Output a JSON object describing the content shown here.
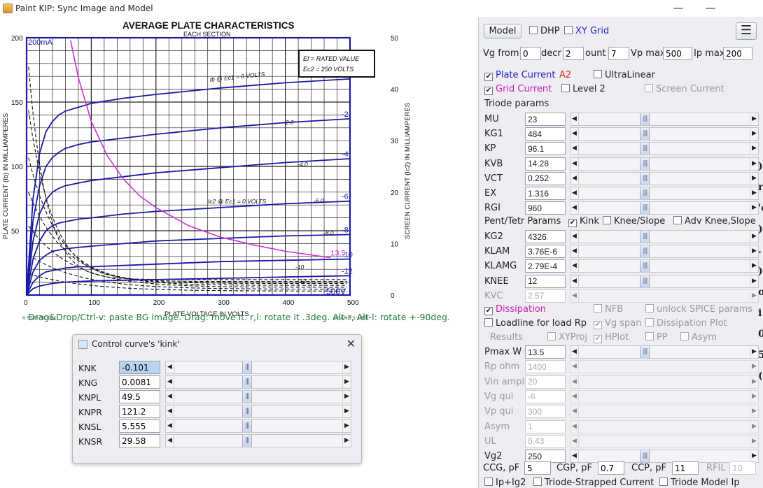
{
  "window": {
    "title": "Paint KIP: Sync Image and Model",
    "min": "—",
    "max": "☐",
    "close": "✕"
  },
  "graph": {
    "title": "AVERAGE PLATE CHARACTERISTICS",
    "subtitle": "EACH SECTION",
    "ylabel_left": "PLATE CURRENT (Ib) IN MILLIAMPERES",
    "ylabel_right": "SCREEN CURRENT (Ic2) IN MILLIAMPERES",
    "xlabel": "PLATE VOLTAGE IN VOLTS",
    "overlay_left_top": "200mA",
    "overlay_right_bottom": "500V",
    "legend_line1": "Ef = RATED VALUE",
    "legend_line2": "Ec2 = 250 VOLTS",
    "curve_label_ec1": "Ib @ Ec1 = 0 VOLTS",
    "curve_label_ic2": "Ic2 @ Ec1 = 0 VOLTS",
    "grid_labels": [
      "-2.0",
      "-4.0",
      "-6.0",
      "-8.0",
      "-10",
      "-12",
      "-2.0",
      "-4.0",
      "-6.0",
      "-8.0",
      "-10",
      "-12"
    ],
    "model_labels": [
      "-2",
      "-4",
      "-6",
      "-8",
      "-10",
      "-12",
      "13.5"
    ],
    "footer_left": "K-5508-TC-001",
    "footer_right": "CHAN 3-1-1959"
  },
  "chart_data": {
    "type": "line",
    "title": "AVERAGE PLATE CHARACTERISTICS",
    "subtitle": "EACH SECTION",
    "xlabel": "PLATE VOLTAGE IN VOLTS",
    "ylabel": "PLATE CURRENT (Ib) IN MILLIAMPERES",
    "ylabel_right": "SCREEN CURRENT (Ic2) IN MILLIAMPERES",
    "xlim": [
      0,
      500
    ],
    "ylim": [
      0,
      200
    ],
    "ylim_right": [
      0,
      50
    ],
    "xticks": [
      "0",
      "100",
      "200",
      "300",
      "400",
      "500"
    ],
    "yticks": [
      "50",
      "100",
      "150",
      "200"
    ],
    "yticks_right": [
      "0",
      "10",
      "20",
      "30",
      "40",
      "50"
    ],
    "grid": true,
    "series": [
      {
        "name": "0",
        "x": [
          0,
          10,
          20,
          30,
          40,
          50,
          60,
          80,
          100,
          150,
          200,
          300,
          400,
          500
        ],
        "y": [
          0,
          75,
          110,
          127,
          135,
          140,
          143,
          146,
          149,
          153,
          156,
          161,
          165,
          168
        ]
      },
      {
        "name": "-2",
        "x": [
          0,
          10,
          20,
          30,
          40,
          50,
          60,
          80,
          100,
          150,
          200,
          300,
          400,
          500
        ],
        "y": [
          0,
          58,
          85,
          100,
          107,
          111,
          114,
          117,
          119,
          122,
          125,
          130,
          134,
          137
        ]
      },
      {
        "name": "-4",
        "x": [
          0,
          10,
          20,
          30,
          40,
          50,
          60,
          80,
          100,
          150,
          200,
          300,
          400,
          500
        ],
        "y": [
          0,
          42,
          63,
          74,
          80,
          83,
          85,
          87,
          89,
          92,
          95,
          99,
          103,
          106
        ]
      },
      {
        "name": "-6",
        "x": [
          0,
          10,
          20,
          30,
          40,
          50,
          60,
          80,
          100,
          150,
          200,
          300,
          400,
          500
        ],
        "y": [
          0,
          28,
          42,
          50,
          54,
          56,
          57,
          59,
          60,
          63,
          65,
          68,
          71,
          73
        ]
      },
      {
        "name": "-8",
        "x": [
          0,
          10,
          20,
          30,
          40,
          50,
          60,
          80,
          100,
          150,
          200,
          300,
          400,
          500
        ],
        "y": [
          0,
          18,
          27,
          31,
          34,
          35,
          36,
          37,
          38,
          40,
          42,
          44,
          46,
          47
        ]
      },
      {
        "name": "-10",
        "x": [
          0,
          10,
          20,
          30,
          40,
          50,
          60,
          80,
          100,
          150,
          200,
          300,
          400,
          500
        ],
        "y": [
          0,
          10,
          15,
          18,
          19,
          20,
          21,
          22,
          22,
          23,
          24,
          26,
          27,
          28
        ]
      },
      {
        "name": "-12",
        "x": [
          0,
          10,
          20,
          30,
          40,
          50,
          60,
          80,
          100,
          150,
          200,
          300,
          400,
          500
        ],
        "y": [
          0,
          5,
          7,
          8,
          9,
          9.5,
          10,
          10.5,
          11,
          11.5,
          12,
          13,
          14,
          15
        ]
      },
      {
        "name": "13.5",
        "x": [
          68,
          80,
          100,
          125,
          150,
          175,
          200,
          250,
          300,
          350,
          400,
          470
        ],
        "y": [
          198,
          169,
          135,
          108,
          90,
          77,
          68,
          54,
          45,
          39,
          34,
          29
        ]
      }
    ]
  },
  "hint": "Drag&Drop/Ctrl-v: paste BG image. Drag: move it. r,l: rotate it .3deg. Alt-r, Alt-l: rotate +-90deg.",
  "dialog": {
    "title": "Control curve's 'kink'",
    "close": "✕",
    "rows": [
      {
        "label": "KNK",
        "value": "-0.101"
      },
      {
        "label": "KNG",
        "value": "0.0081"
      },
      {
        "label": "KNPL",
        "value": "49.5"
      },
      {
        "label": "KNPR",
        "value": "121.2"
      },
      {
        "label": "KNSL",
        "value": "5.555"
      },
      {
        "label": "KNSR",
        "value": "29.58"
      }
    ]
  },
  "panel": {
    "model_button": "Model",
    "dhp": "DHP",
    "xy_grid": "XY Grid",
    "menu_icon": "☰",
    "vg_from_label": "Vg from",
    "vg_from": "0",
    "decr_label": "decr",
    "decr": "2",
    "count_label": "ount",
    "count": "7",
    "vpmax_label": "Vp max",
    "vpmax": "500",
    "ipmax_label": "Ip max",
    "ipmax": "200",
    "plate_current": "Plate Current",
    "a2": "A2",
    "ultralinear": "UltraLinear",
    "grid_current": "Grid Current",
    "level2": "Level 2",
    "screen_current": "Screen Current",
    "triode_params": "Triode params",
    "triode": [
      {
        "label": "MU",
        "value": "23"
      },
      {
        "label": "KG1",
        "value": "484"
      },
      {
        "label": "KP",
        "value": "96.1"
      },
      {
        "label": "KVB",
        "value": "14.28"
      },
      {
        "label": "VCT",
        "value": "0.252"
      },
      {
        "label": "EX",
        "value": "1.316"
      },
      {
        "label": "RGI",
        "value": "960"
      }
    ],
    "pent_params": "Pent/Tetr Params",
    "kink": "Kink",
    "knee_slope": "Knee/Slope",
    "adv_knee": "Adv Knee,Slope",
    "pent": [
      {
        "label": "KG2",
        "value": "4326"
      },
      {
        "label": "KLAM",
        "value": "3.76E-6"
      },
      {
        "label": "KLAMG",
        "value": "2.79E-4"
      },
      {
        "label": "KNEE",
        "value": "12"
      },
      {
        "label": "KVC",
        "value": "2.57"
      }
    ],
    "dissipation": "Dissipation",
    "nfb": "NFB",
    "unlock_spice": "unlock SPICE params",
    "loadline": "Loadline for load Rp",
    "vg_span": "Vg span",
    "dissipation_plot": "Dissipation Plot",
    "results": "Results",
    "xyproj": "XYProj",
    "hplot": "HPlot",
    "pp": "PP",
    "asym_cb": "Asym",
    "lower": [
      {
        "label": "Pmax W",
        "value": "13.5",
        "enabled": true
      },
      {
        "label": "Rp ohm",
        "value": "1400",
        "enabled": false
      },
      {
        "label": "Vin ampl",
        "value": "20",
        "enabled": false
      },
      {
        "label": "Vg qui",
        "value": "-6",
        "enabled": false
      },
      {
        "label": "Vp qui",
        "value": "300",
        "enabled": false
      },
      {
        "label": "Asym",
        "value": "1",
        "enabled": false
      },
      {
        "label": "UL",
        "value": "0.43",
        "enabled": false
      },
      {
        "label": "Vg2",
        "value": "250",
        "enabled": true
      }
    ],
    "ccg_label": "CCG, pF",
    "ccg": "5",
    "cgp_label": "CGP, pF",
    "cgp": "0.7",
    "ccp_label": "CCP, pF",
    "ccp": "11",
    "rfil_label": "RFIL",
    "rfil": "10",
    "ip_ig2": "Ip+Ig2",
    "triode_strapped": "Triode-Strapped Current",
    "triode_model_ip": "Triode Model Ip",
    "right_strip": [
      ")",
      "r",
      "'e",
      ")",
      ".",
      ")",
      "o",
      "i",
      "0",
      "5",
      "("
    ]
  },
  "colors": {
    "model_curve": "#1a1aa8",
    "dissipation": "#d630d6",
    "hint": "#1f7d3a",
    "panel_bg": "#eeeef2"
  }
}
